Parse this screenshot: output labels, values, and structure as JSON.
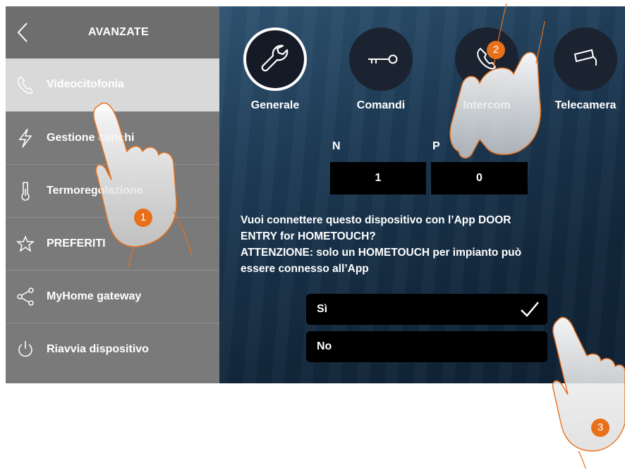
{
  "sidebar": {
    "title": "AVANZATE",
    "items": [
      {
        "label": "Videocitofonia",
        "icon": "handset-icon"
      },
      {
        "label": "Gestione carichi",
        "icon": "lightning-icon"
      },
      {
        "label": "Termoregolazione",
        "icon": "thermometer-icon"
      },
      {
        "label": "PREFERITI",
        "icon": "star-icon"
      },
      {
        "label": "MyHome gateway",
        "icon": "share-icon"
      },
      {
        "label": "Riavvia dispositivo",
        "icon": "power-icon"
      }
    ],
    "active_item": "Videocitofonia"
  },
  "tabs": [
    {
      "label": "Generale",
      "icon": "wrench-icon"
    },
    {
      "label": "Comandi",
      "icon": "key-icon"
    },
    {
      "label": "Intercom",
      "icon": "handset-icon"
    },
    {
      "label": "Telecamera",
      "icon": "camera-icon"
    }
  ],
  "active_tab": "Generale",
  "address": {
    "n_label": "N",
    "p_label": "P",
    "n_value": "1",
    "p_value": "0"
  },
  "question": {
    "line1": "Vuoi connettere questo dispositivo con l’App DOOR",
    "line2": "ENTRY for HOMETOUCH?",
    "line3": "ATTENZIONE: solo un HOMETOUCH per impianto può",
    "line4": "essere connesso all’App"
  },
  "options": [
    {
      "label": "Sì",
      "selected": true
    },
    {
      "label": "No",
      "selected": false
    }
  ],
  "callouts": [
    "1",
    "2",
    "3"
  ],
  "colors": {
    "sidebar": "#7a7a7a",
    "active_item": "#d9d9d9",
    "panel": "#1e3b55",
    "callout": "#e8701a"
  }
}
